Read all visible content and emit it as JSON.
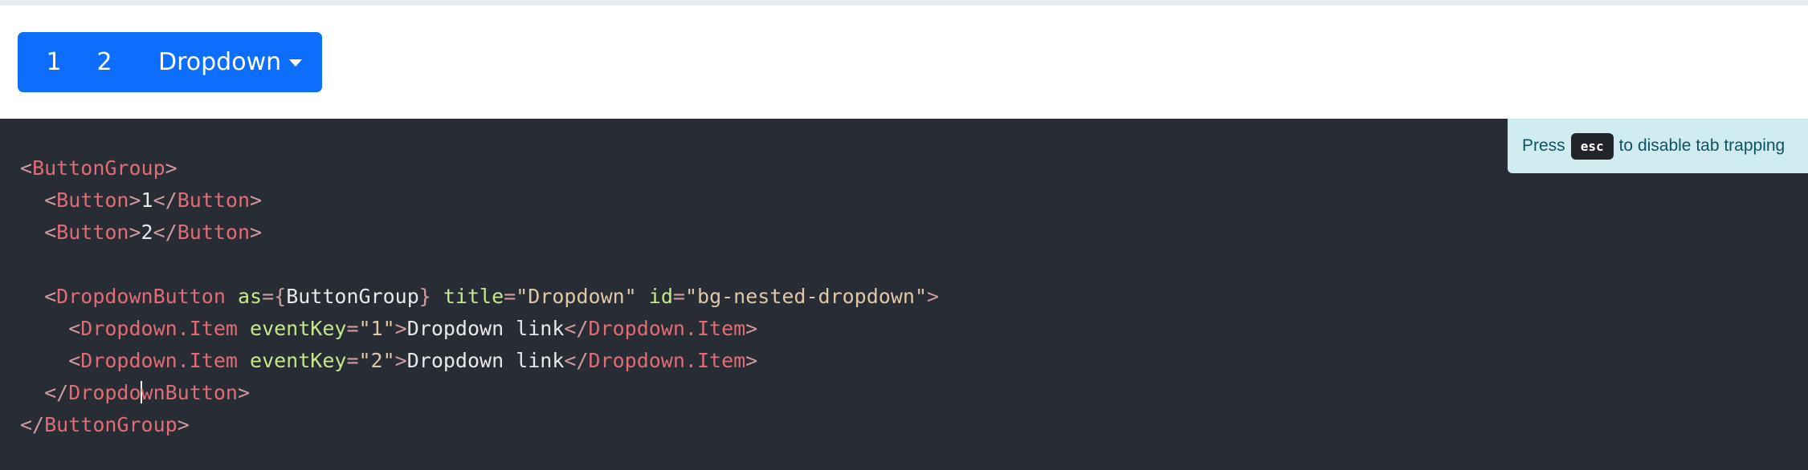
{
  "preview": {
    "buttons": [
      "1",
      "2"
    ],
    "dropdown_label": "Dropdown"
  },
  "hint": {
    "prefix": "Press",
    "key": "esc",
    "suffix": "to disable tab trapping"
  },
  "code": {
    "line1": {
      "open": "<",
      "tag": "ButtonGroup",
      "close": ">"
    },
    "line2": {
      "indent": "  ",
      "open": "<",
      "tag": "Button",
      "close": ">",
      "text": "1",
      "end_open": "</",
      "end_tag": "Button",
      "end_close": ">"
    },
    "line3": {
      "indent": "  ",
      "open": "<",
      "tag": "Button",
      "close": ">",
      "text": "2",
      "end_open": "</",
      "end_tag": "Button",
      "end_close": ">"
    },
    "line5": {
      "indent": "  ",
      "open": "<",
      "tag": "DropdownButton",
      "attr1": "as",
      "eq1": "=",
      "val1_open": "{",
      "val1": "ButtonGroup",
      "val1_close": "}",
      "attr2": "title",
      "eq2": "=",
      "val2": "\"Dropdown\"",
      "attr3": "id",
      "eq3": "=",
      "val3": "\"bg-nested-dropdown\"",
      "close": ">"
    },
    "line6": {
      "indent": "    ",
      "open": "<",
      "tag": "Dropdown.Item",
      "attr": "eventKey",
      "eq": "=",
      "val": "\"1\"",
      "close": ">",
      "text": "Dropdown link",
      "end_open": "</",
      "end_tag": "Dropdown.Item",
      "end_close": ">"
    },
    "line7": {
      "indent": "    ",
      "open": "<",
      "tag": "Dropdown.Item",
      "attr": "eventKey",
      "eq": "=",
      "val": "\"2\"",
      "close": ">",
      "text": "Dropdown link",
      "end_open": "</",
      "end_tag": "Dropdown.Item",
      "end_close": ">"
    },
    "line8": {
      "indent": "  ",
      "open": "</",
      "tag_a": "Dropdo",
      "tag_b": "wnButton",
      "close": ">"
    },
    "line9": {
      "open": "</",
      "tag": "ButtonGroup",
      "close": ">"
    }
  }
}
